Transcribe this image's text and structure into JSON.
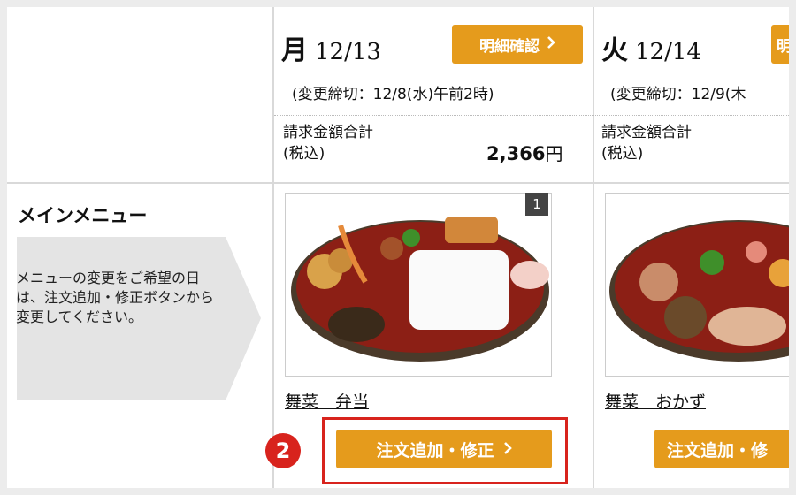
{
  "days": [
    {
      "dow": "月",
      "date": "12/13",
      "detail_label": "明細確認",
      "deadline": "(変更締切：12/8(水)午前2時)",
      "billing_line1": "請求金額合計",
      "billing_line2": "(税込)",
      "amount": "2,366",
      "currency": "円",
      "badge": "1",
      "item_name": "舞菜　弁当",
      "order_label": "注文追加・修正"
    },
    {
      "dow": "火",
      "date": "12/14",
      "detail_label": "明",
      "deadline": "(変更締切：12/9(木",
      "billing_line1": "請求金額合計",
      "billing_line2": "(税込)",
      "item_name": "舞菜　おかず",
      "order_label": "注文追加・修"
    }
  ],
  "main_menu": {
    "title": "メインメニュー",
    "note": "メニューの変更をご希望の日は、注文追加・修正ボタンから変更してください。"
  },
  "step_marker": "2",
  "icons": {
    "chevron": "chevron-right-icon"
  },
  "colors": {
    "accent": "#e59b1c",
    "highlight": "#d8231d",
    "callout": "#e4e4e4"
  }
}
